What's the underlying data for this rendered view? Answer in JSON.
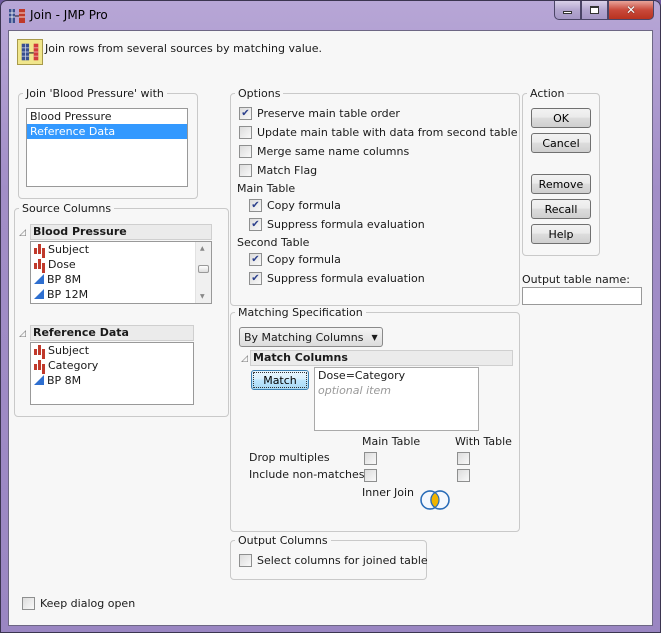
{
  "window": {
    "title": "Join - JMP Pro",
    "controls": {
      "minimize": "minimize",
      "maximize": "maximize",
      "close": "close"
    }
  },
  "banner": {
    "icon": "join-tables-icon",
    "text": "Join rows from several sources by matching value."
  },
  "join_with": {
    "legend": "Join 'Blood Pressure' with",
    "items": [
      {
        "label": "Blood Pressure",
        "selected": false
      },
      {
        "label": "Reference Data",
        "selected": true
      }
    ]
  },
  "source_columns": {
    "legend": "Source Columns",
    "tables": [
      {
        "name": "Blood Pressure",
        "columns": [
          {
            "label": "Subject",
            "type": "nominal"
          },
          {
            "label": "Dose",
            "type": "nominal"
          },
          {
            "label": "BP 8M",
            "type": "continuous"
          },
          {
            "label": "BP 12M",
            "type": "continuous"
          }
        ]
      },
      {
        "name": "Reference Data",
        "columns": [
          {
            "label": "Subject",
            "type": "nominal"
          },
          {
            "label": "Category",
            "type": "nominal"
          },
          {
            "label": "BP 8M",
            "type": "continuous"
          }
        ]
      }
    ]
  },
  "options": {
    "legend": "Options",
    "preserve_order": {
      "label": "Preserve main table order",
      "checked": true
    },
    "update_main": {
      "label": "Update main table with data from second table",
      "checked": false
    },
    "merge_same": {
      "label": "Merge same name columns",
      "checked": false
    },
    "match_flag": {
      "label": "Match Flag",
      "checked": false
    },
    "main_table": {
      "heading": "Main Table",
      "copy_formula": {
        "label": "Copy formula",
        "checked": true
      },
      "suppress_eval": {
        "label": "Suppress formula evaluation",
        "checked": true
      }
    },
    "second_table": {
      "heading": "Second Table",
      "copy_formula": {
        "label": "Copy formula",
        "checked": true
      },
      "suppress_eval": {
        "label": "Suppress formula evaluation",
        "checked": true
      }
    }
  },
  "action": {
    "legend": "Action",
    "ok": "OK",
    "cancel": "Cancel",
    "remove": "Remove",
    "recall": "Recall",
    "help": "Help"
  },
  "output_table": {
    "label": "Output table name:",
    "value": ""
  },
  "matching": {
    "legend": "Matching Specification",
    "method": "By Matching Columns",
    "match_columns_header": "Match Columns",
    "match_button": "Match",
    "pairs": [
      "Dose=Category"
    ],
    "optional_placeholder": "optional item",
    "main_table_header": "Main Table",
    "with_table_header": "With Table",
    "drop_multiples": {
      "label": "Drop multiples",
      "main": false,
      "with": false
    },
    "include_nonmatches": {
      "label": "Include non-matches",
      "main": false,
      "with": false
    },
    "join_type_label": "Inner Join",
    "join_type_icon": "inner-join-venn-icon"
  },
  "output_columns": {
    "legend": "Output Columns",
    "select_columns": {
      "label": "Select columns for joined table",
      "checked": false
    }
  },
  "keep_open": {
    "label": "Keep dialog open",
    "checked": false
  },
  "colors": {
    "selection": "#3399ff",
    "nominal_icon": "#c0392b",
    "continuous_icon": "#2e6fd0",
    "check": "#2b3f8c"
  }
}
